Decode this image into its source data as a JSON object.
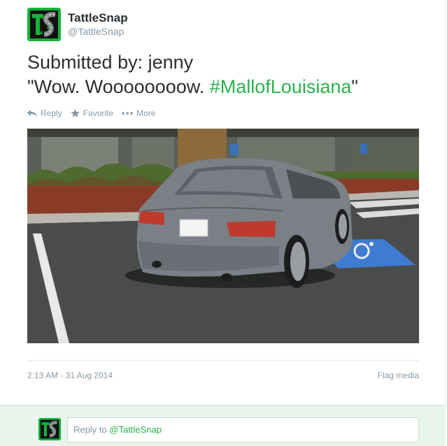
{
  "user": {
    "name": "TattleSnap",
    "handle": "@TattleSnap"
  },
  "tweet": {
    "line1": "Submitted by: jenny",
    "line2_prefix": "\"Wow. Woooooooow. ",
    "hashtag": "#MallofLouisiana",
    "line2_suffix": "\""
  },
  "actions": {
    "reply": "Reply",
    "favorite": "Favorite",
    "more": "More"
  },
  "meta": {
    "timestamp": "2:13 AM - 31 Aug 2014",
    "flag": "Flag media"
  },
  "reply_box": {
    "prefix": "Reply to ",
    "mention": "@TattleSnap"
  },
  "colors": {
    "accent": "#2bb24c",
    "brand_green": "#16b33b"
  }
}
